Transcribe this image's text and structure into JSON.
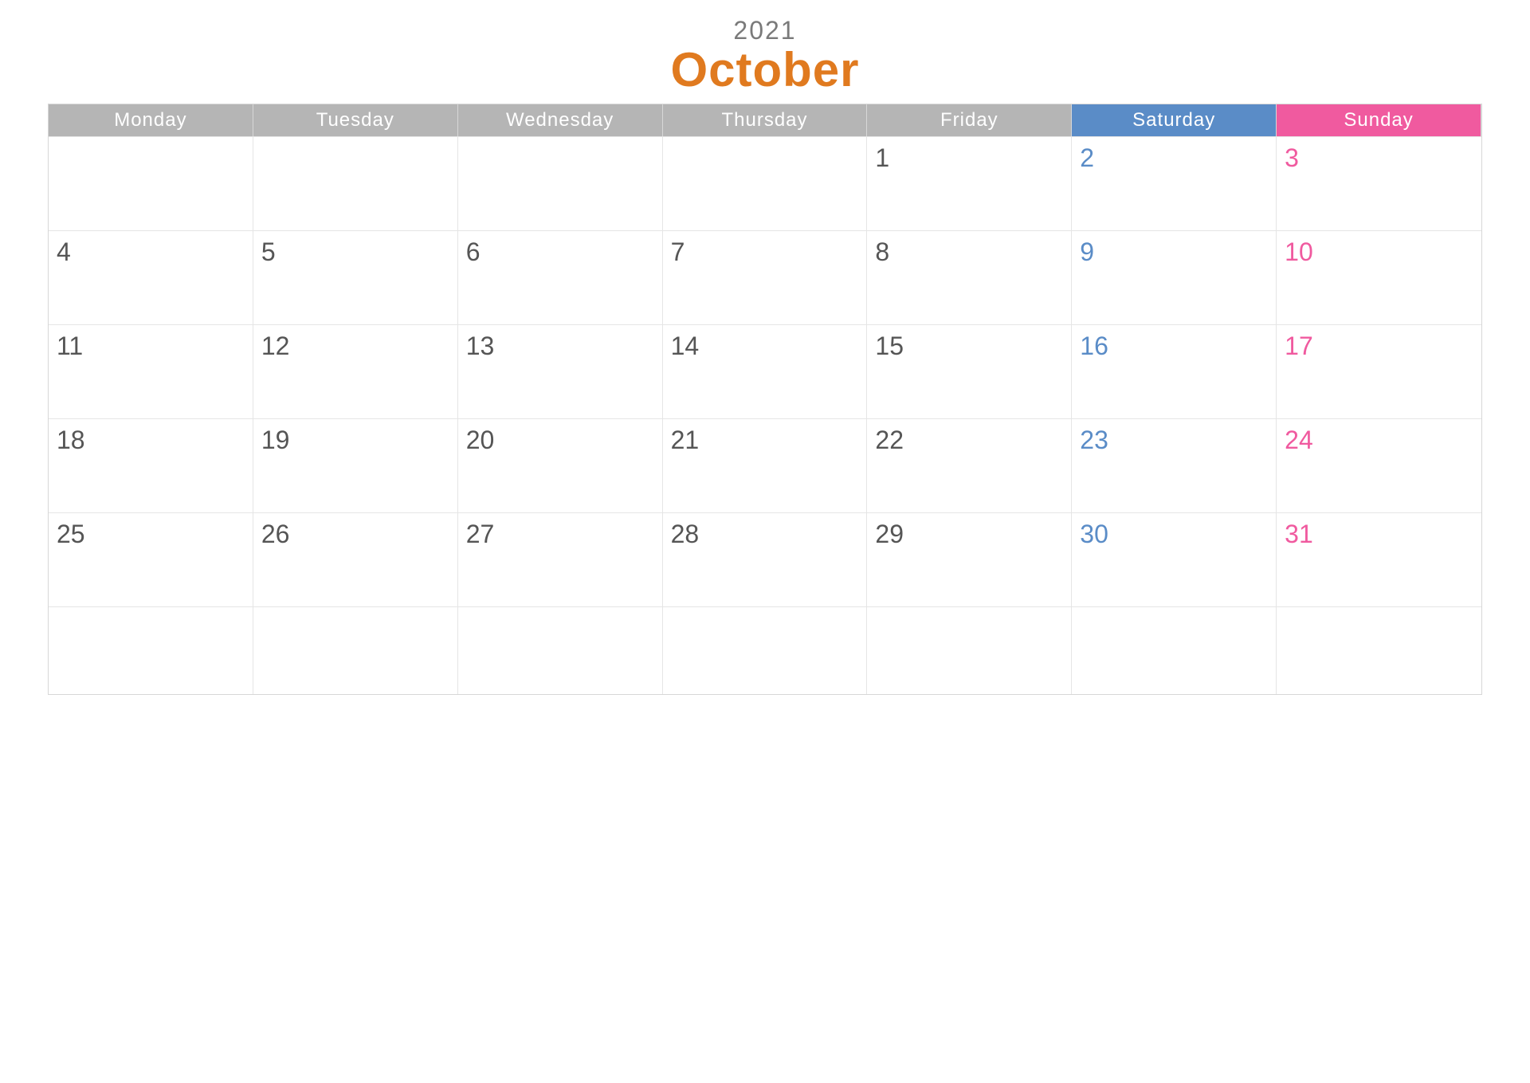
{
  "year": "2021",
  "month": "October",
  "days_of_week": [
    "Monday",
    "Tuesday",
    "Wednesday",
    "Thursday",
    "Friday",
    "Saturday",
    "Sunday"
  ],
  "grid": [
    [
      "",
      "",
      "",
      "",
      "1",
      "2",
      "3"
    ],
    [
      "4",
      "5",
      "6",
      "7",
      "8",
      "9",
      "10"
    ],
    [
      "11",
      "12",
      "13",
      "14",
      "15",
      "16",
      "17"
    ],
    [
      "18",
      "19",
      "20",
      "21",
      "22",
      "23",
      "24"
    ],
    [
      "25",
      "26",
      "27",
      "28",
      "29",
      "30",
      "31"
    ],
    [
      "",
      "",
      "",
      "",
      "",
      "",
      ""
    ]
  ],
  "colors": {
    "weekday_header_bg": "#b5b5b5",
    "saturday_header_bg": "#5a8cc7",
    "sunday_header_bg": "#f05a9f",
    "month_color": "#e07a1f",
    "year_color": "#7a7a7a",
    "weekday_text": "#555555",
    "saturday_text": "#5a8cc7",
    "sunday_text": "#f05a9f"
  }
}
